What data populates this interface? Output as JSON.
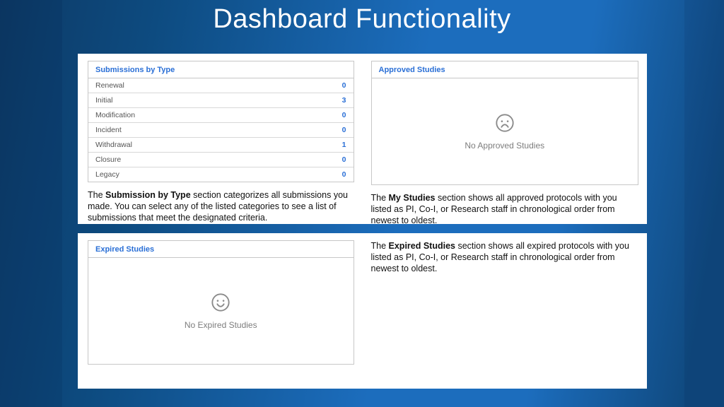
{
  "title": "Dashboard Functionality",
  "top": {
    "submissions": {
      "header": "Submissions by Type",
      "items": [
        {
          "label": "Renewal",
          "count": 0
        },
        {
          "label": "Initial",
          "count": 3
        },
        {
          "label": "Modification",
          "count": 0
        },
        {
          "label": "Incident",
          "count": 0
        },
        {
          "label": "Withdrawal",
          "count": 1
        },
        {
          "label": "Closure",
          "count": 0
        },
        {
          "label": "Legacy",
          "count": 0
        }
      ],
      "caption_prefix": "The ",
      "caption_bold": "Submission by Type",
      "caption_rest": " section categorizes all submissions you made. You can select any of the listed categories to see a list of submissions that meet the designated criteria."
    },
    "approved": {
      "header": "Approved Studies",
      "empty_message": "No Approved Studies",
      "caption_prefix": "The ",
      "caption_bold": "My Studies",
      "caption_rest": " section shows all approved protocols with you listed as PI, Co-I, or Research staff in chronological order from newest to oldest."
    }
  },
  "bottom": {
    "expired": {
      "header": "Expired Studies",
      "empty_message": "No Expired Studies",
      "caption_prefix": "The ",
      "caption_bold": "Expired Studies",
      "caption_rest": " section shows all expired protocols with you listed as PI, Co-I, or Research staff in chronological order from newest to oldest."
    }
  }
}
